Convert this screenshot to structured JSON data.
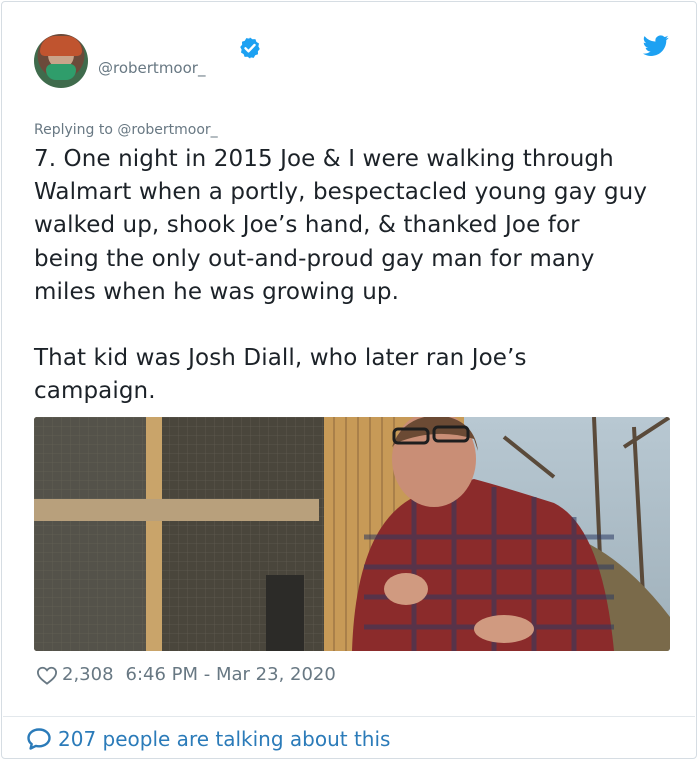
{
  "author": {
    "handle": "@robertmoor_",
    "verified": true,
    "avatar_icon": "user-avatar"
  },
  "replying_to": "Replying to @robertmoor_",
  "tweet_text": "7. One night in 2015 Joe & I were walking through\nWalmart when a portly, bespectacled young gay guy\nwalked up, shook Joe’s hand, & thanked Joe for\nbeing the only out-and-proud gay man for many\nmiles when he was growing up.\n\nThat kid was Josh Diall, who later ran Joe’s\ncampaign.",
  "stats": {
    "likes": "2,308",
    "timestamp": "6:46 PM - Mar 23, 2020"
  },
  "footer": {
    "talking": "207 people are talking about this"
  },
  "colors": {
    "twitter_blue": "#1da1f2",
    "link_blue": "#2b7bb9",
    "muted_gray": "#687883",
    "text": "#1c2228"
  }
}
